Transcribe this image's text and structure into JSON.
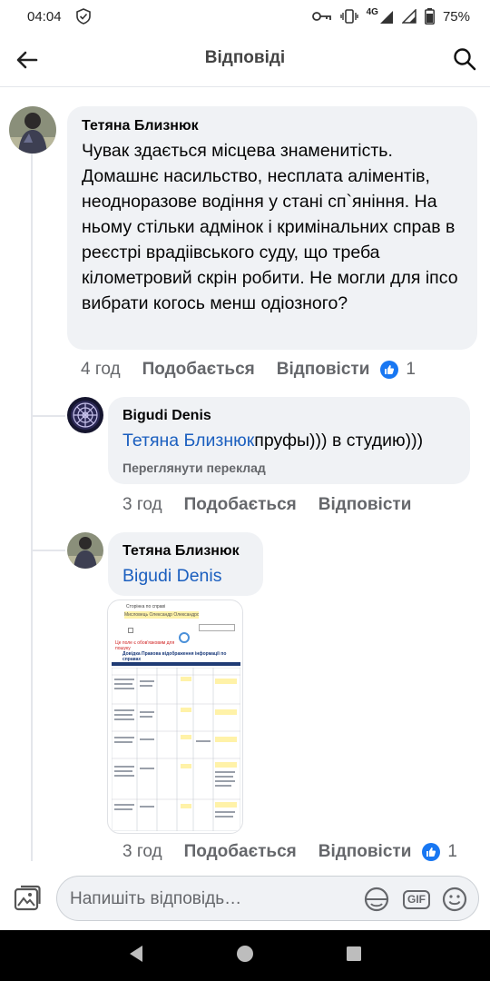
{
  "status_bar": {
    "time": "04:04",
    "network": "4G",
    "battery": "75%"
  },
  "header": {
    "title": "Відповіді"
  },
  "comments": [
    {
      "author": "Тетяна Близнюк",
      "text": "Чувак здається місцева знаменитість. Домашнє насильство, несплата аліментів, неодноразове водіння у стані сп`яніння. На ньому стільки адмінок і кримінальних справ в реєстрі врадіівського суду, що треба кілометровий скрін робити. Не могли для іпсо вибрати когось менш одіозного?",
      "time": "4 год",
      "like_label": "Подобається",
      "reply_label": "Відповісти",
      "reaction_count": "1"
    },
    {
      "author": "Bigudi Denis",
      "mention": "Тетяна Близнюк",
      "text": "пруфы))) в студию)))",
      "translate_label": "Переглянути переклад",
      "time": "3 год",
      "like_label": "Подобається",
      "reply_label": "Відповісти"
    },
    {
      "author": "Тетяна Близнюк",
      "mention": "Bigudi Denis",
      "time": "3 год",
      "like_label": "Подобається",
      "reply_label": "Відповісти",
      "reaction_count": "1",
      "attachment": {
        "page_heading": "Сторінка по справі",
        "highlighted_name": "Мисловець Олександр Олександрович",
        "notice": "Це поле є обов'язковим для пошуку",
        "table_title": "Довідка    Правова відображення інформації по справах"
      }
    }
  ],
  "composer": {
    "placeholder": "Напишіть відповідь…",
    "gif_label": "GIF"
  },
  "colors": {
    "link": "#1b5fbf",
    "bubble": "#f0f2f5",
    "like_badge": "#1877f2",
    "muted": "#65676b"
  }
}
